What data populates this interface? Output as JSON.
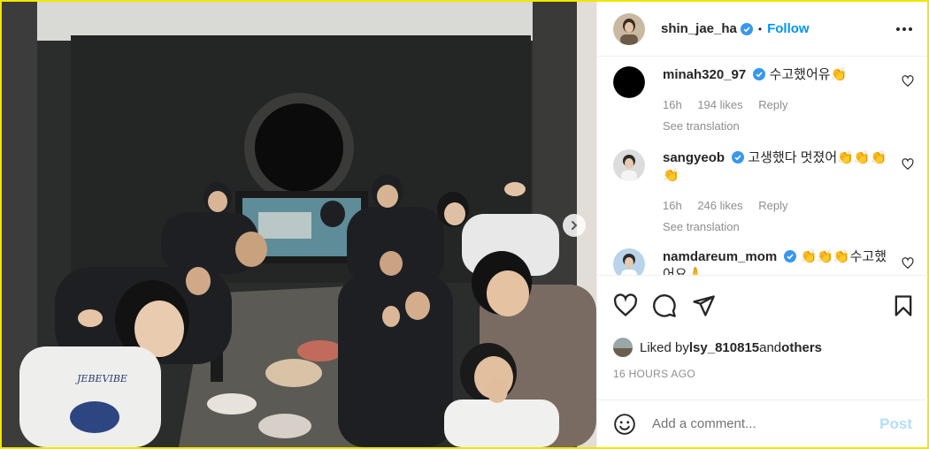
{
  "post": {
    "username": "shin_jae_ha",
    "follow_label": "Follow",
    "separator": "•",
    "more_icon": "more-horizontal-icon"
  },
  "comments": [
    {
      "username": "minah320_97",
      "verified": true,
      "text": "수고했어유👏",
      "time": "16h",
      "likes": "194 likes",
      "reply_label": "Reply",
      "see_translation": "See translation"
    },
    {
      "username": "sangyeob",
      "verified": true,
      "text": "고생했다 멋졌어👏👏👏👏",
      "time": "16h",
      "likes": "246 likes",
      "reply_label": "Reply",
      "see_translation": "See translation"
    },
    {
      "username": "namdareum_mom",
      "verified": true,
      "text": "👏👏👏수고했어요🙏",
      "time": "",
      "likes": "",
      "reply_label": "",
      "see_translation": ""
    }
  ],
  "liked_by": {
    "prefix": "Liked by ",
    "user": "lsy_810815",
    "middle": " and ",
    "others": "others"
  },
  "timestamp": "16 HOURS AGO",
  "add_comment": {
    "placeholder": "Add a comment...",
    "post_label": "Post"
  },
  "colors": {
    "follow": "#0095f6",
    "verified": "#3897f0",
    "post_disabled": "#b2dffc",
    "border_highlight": "#f2e600"
  }
}
